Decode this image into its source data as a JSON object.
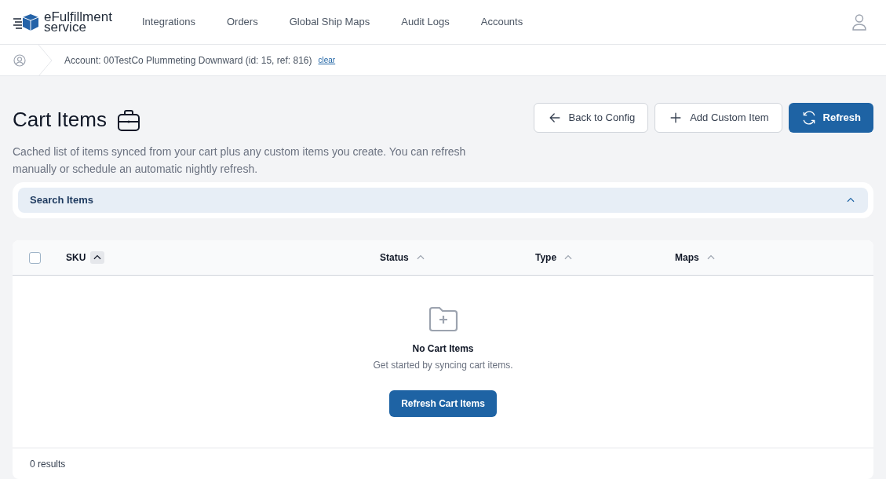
{
  "logo": {
    "line_1": "eFulfillment",
    "line_2": "service"
  },
  "nav": [
    {
      "label": "Integrations"
    },
    {
      "label": "Orders"
    },
    {
      "label": "Global Ship Maps"
    },
    {
      "label": "Audit Logs"
    },
    {
      "label": "Accounts"
    }
  ],
  "breadcrumb": {
    "text": "Account: 00TestCo Plummeting Downward (id: 15, ref: 816)",
    "link": "clear"
  },
  "page": {
    "title": "Cart Items",
    "description": "Cached list of items synced from your cart plus any custom items you create. You can refresh manually or schedule an automatic nightly refresh."
  },
  "actions": [
    {
      "label": "Back to Config",
      "kind": "back"
    },
    {
      "label": "Add Custom Item",
      "kind": "add"
    },
    {
      "label": "Refresh",
      "kind": "refresh"
    }
  ],
  "search_panel": {
    "label": "Search Items",
    "expanded": true
  },
  "table": {
    "select_all_checked": false,
    "columns": [
      {
        "label": "SKU",
        "selected": true
      },
      {
        "label": "Status",
        "selected": false
      },
      {
        "label": "Type",
        "selected": false
      },
      {
        "label": "Maps",
        "selected": false
      }
    ],
    "empty": {
      "title": "No Cart Items",
      "message": "Get started by syncing cart items.",
      "button": "Refresh Cart Items"
    },
    "footer": "0 results"
  }
}
